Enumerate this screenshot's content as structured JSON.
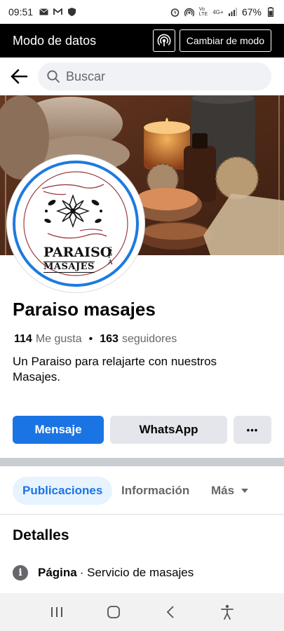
{
  "status_bar": {
    "time": "09:51",
    "battery": "67%",
    "left_icons": [
      "mail-icon",
      "gmail-icon",
      "shield-icon"
    ],
    "right_icons": [
      "alarm-icon",
      "hotspot-icon",
      "volte-icon",
      "4g-icon",
      "signal-icon",
      "battery-icon"
    ]
  },
  "data_bar": {
    "title": "Modo de datos",
    "change_label": "Cambiar de modo"
  },
  "search": {
    "placeholder": "Buscar"
  },
  "profile": {
    "logo_text_line1": "PARAISO",
    "logo_text_line2": "MASAJES",
    "logo_spa": "SPA",
    "name": "Paraiso masajes",
    "likes_count": "114",
    "likes_label": "Me gusta",
    "separator": "•",
    "followers_count": "163",
    "followers_label": "seguidores",
    "bio": "Un Paraiso para relajarte con nuestros Masajes."
  },
  "actions": {
    "message": "Mensaje",
    "whatsapp": "WhatsApp",
    "more": "•••"
  },
  "tabs": [
    {
      "label": "Publicaciones",
      "active": true
    },
    {
      "label": "Información",
      "active": false
    },
    {
      "label": "Más",
      "active": false
    }
  ],
  "details": {
    "title": "Detalles",
    "category_label": "Página",
    "category_value": "· Servicio de masajes"
  },
  "colors": {
    "primary": "#1b74e4",
    "avatar_ring": "#1d7ae0",
    "secondary_button": "#e4e6eb",
    "data_bar": "#000000"
  }
}
